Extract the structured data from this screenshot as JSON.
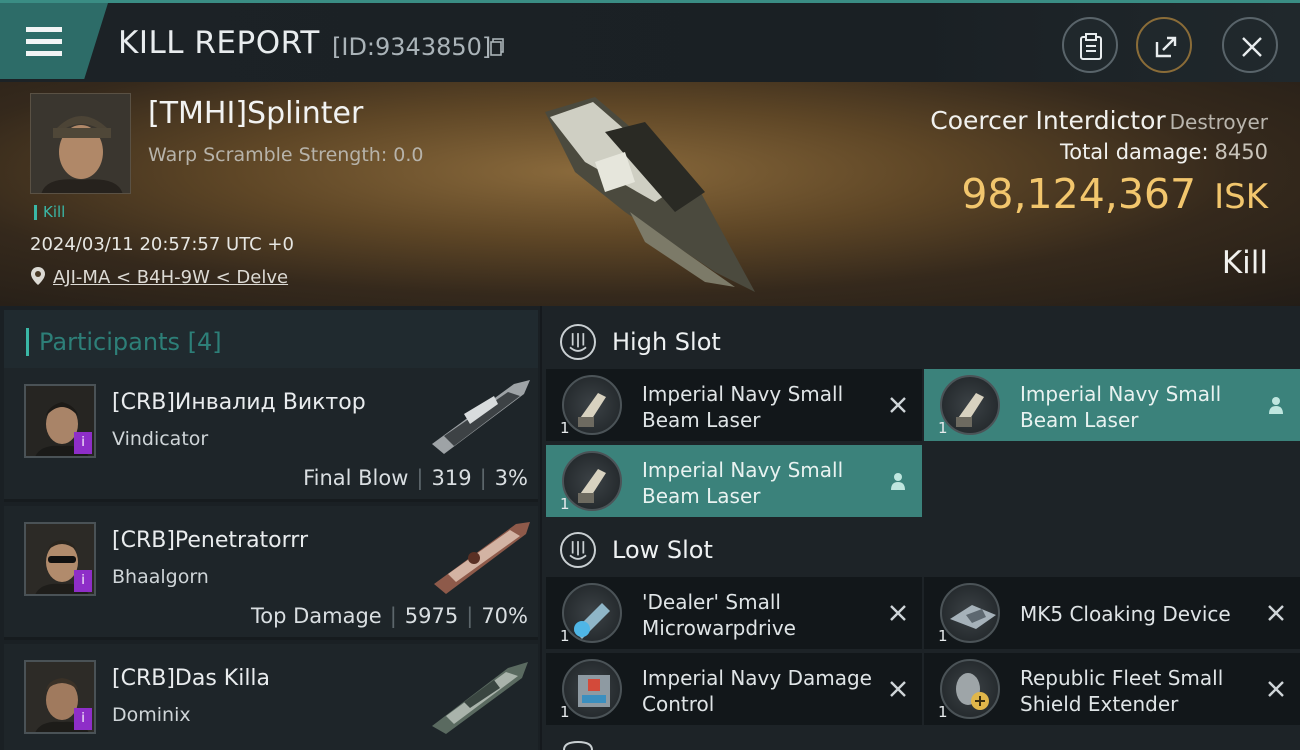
{
  "header": {
    "title": "KILL REPORT",
    "report_id": "[ID:9343850]"
  },
  "victim": {
    "name": "[TMHI]Splinter",
    "scram": "Warp Scramble Strength: 0.0",
    "tag": "Kill",
    "datetime": "2024/03/11 20:57:57 UTC +0",
    "location": "AJI-MA < B4H-9W < Delve"
  },
  "ship": {
    "name": "Coercer Interdictor",
    "class": "Destroyer",
    "total_damage_label": "Total damage:",
    "total_damage": "8450",
    "isk_value": "98,124,367",
    "isk_unit": "ISK",
    "result": "Kill"
  },
  "participants": {
    "title": "Participants",
    "count": "[4]",
    "rows": [
      {
        "name": "[CRB]Инвалид Виктор",
        "ship": "Vindicator",
        "stat_label": "Final Blow",
        "damage": "319",
        "percent": "3%"
      },
      {
        "name": "[CRB]Penetratorrr",
        "ship": "Bhaalgorn",
        "stat_label": "Top Damage",
        "damage": "5975",
        "percent": "70%"
      },
      {
        "name": "[CRB]Das Killa",
        "ship": "Dominix"
      }
    ]
  },
  "fitting": {
    "high_slot_label": "High Slot",
    "low_slot_label": "Low Slot",
    "high": [
      {
        "name": "Imperial Navy Small Beam Laser",
        "qty": "1",
        "status": "destroyed"
      },
      {
        "name": "Imperial Navy Small Beam Laser",
        "qty": "1",
        "status": "dropped"
      },
      {
        "name": "Imperial Navy Small Beam Laser",
        "qty": "1",
        "status": "dropped"
      }
    ],
    "low": [
      {
        "name": "'Dealer' Small Microwarpdrive",
        "qty": "1",
        "status": "destroyed"
      },
      {
        "name": "MK5 Cloaking Device",
        "qty": "1",
        "status": "destroyed"
      },
      {
        "name": "Imperial Navy Damage Control",
        "qty": "1",
        "status": "destroyed"
      },
      {
        "name": "Republic Fleet Small Shield Extender",
        "qty": "1",
        "status": "destroyed"
      }
    ]
  },
  "colors": {
    "accent": "#3ab7a6",
    "isk": "#f2c66d",
    "selected": "#3b827b"
  }
}
